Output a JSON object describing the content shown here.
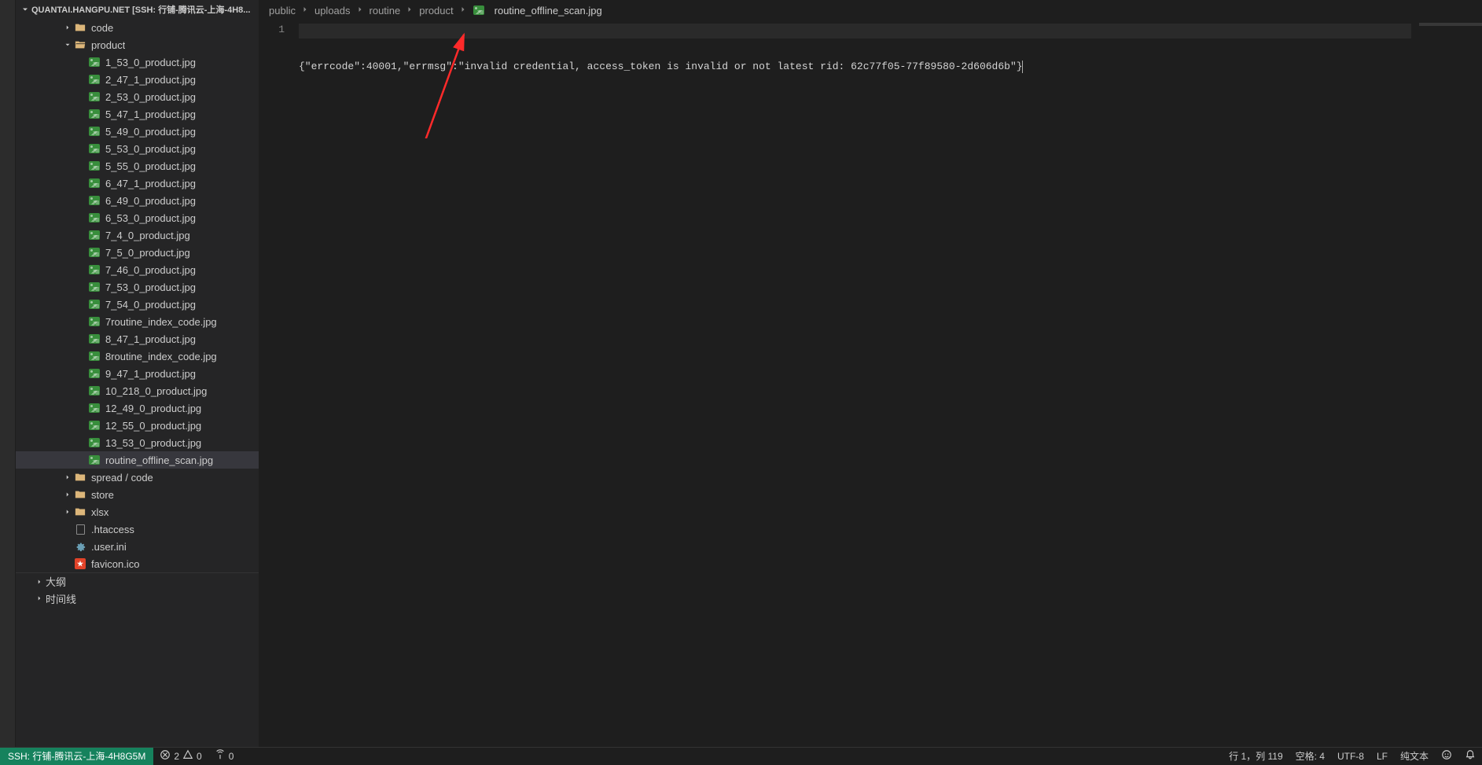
{
  "sidebar": {
    "workspace_title": "QUANTAI.HANGPU.NET [SSH: 行铺-腾讯云-上海-4H8...",
    "folders": {
      "code": "code",
      "product": "product",
      "spread_code": "spread / code",
      "store": "store",
      "xlsx": "xlsx"
    },
    "product_files": [
      "1_53_0_product.jpg",
      "2_47_1_product.jpg",
      "2_53_0_product.jpg",
      "5_47_1_product.jpg",
      "5_49_0_product.jpg",
      "5_53_0_product.jpg",
      "5_55_0_product.jpg",
      "6_47_1_product.jpg",
      "6_49_0_product.jpg",
      "6_53_0_product.jpg",
      "7_4_0_product.jpg",
      "7_5_0_product.jpg",
      "7_46_0_product.jpg",
      "7_53_0_product.jpg",
      "7_54_0_product.jpg",
      "7routine_index_code.jpg",
      "8_47_1_product.jpg",
      "8routine_index_code.jpg",
      "9_47_1_product.jpg",
      "10_218_0_product.jpg",
      "12_49_0_product.jpg",
      "12_55_0_product.jpg",
      "13_53_0_product.jpg",
      "routine_offline_scan.jpg"
    ],
    "root_files": {
      "htaccess": ".htaccess",
      "userini": ".user.ini",
      "favicon": "favicon.ico"
    },
    "outline": "大纲",
    "timeline": "时间线"
  },
  "breadcrumb": {
    "parts": [
      "public",
      "uploads",
      "routine",
      "product"
    ],
    "current": "routine_offline_scan.jpg"
  },
  "editor": {
    "line_number": "1",
    "content": "{\"errcode\":40001,\"errmsg\":\"invalid credential, access_token is invalid or not latest rid: 62c77f05-77f89580-2d606d6b\"}"
  },
  "statusbar": {
    "remote": "SSH: 行铺-腾讯云-上海-4H8G5M",
    "errors": "2",
    "warnings": "0",
    "ports": "0",
    "line_col": "行 1，列 119",
    "spaces": "空格: 4",
    "encoding": "UTF-8",
    "eol": "LF",
    "lang": "纯文本"
  }
}
